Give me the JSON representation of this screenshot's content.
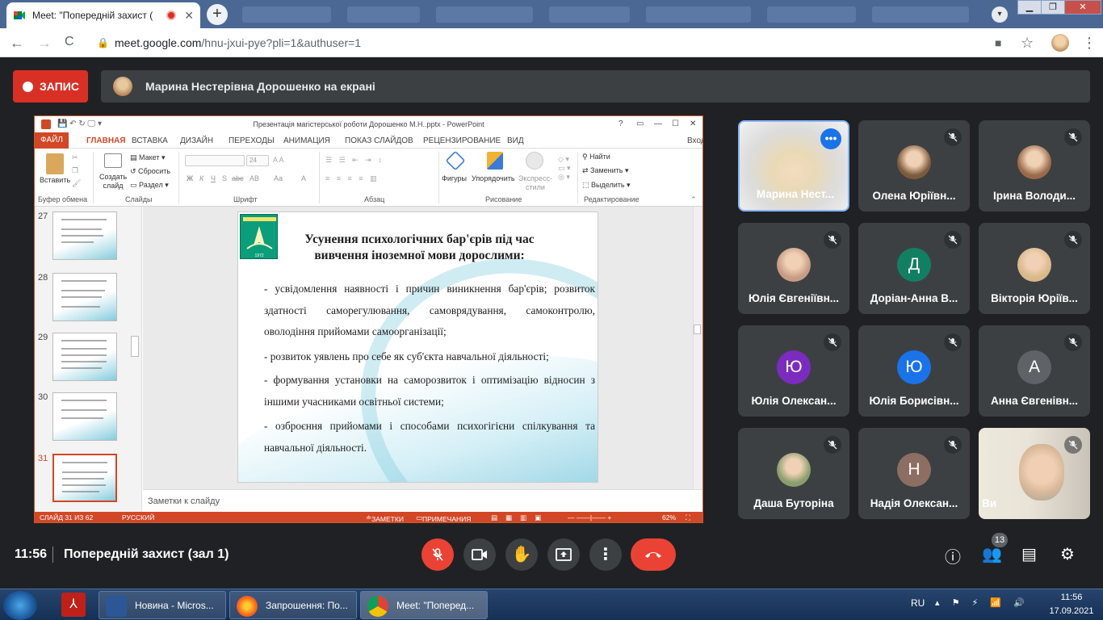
{
  "browser": {
    "tab_title": "Meet: \"Попередній захист (",
    "close_glyph": "✕",
    "new_tab_glyph": "+",
    "back_glyph": "←",
    "forward_glyph": "→",
    "reload_glyph": "C",
    "lock_glyph": "🔒",
    "url_host": "meet.google.com",
    "url_path": "/hnu-jxui-pye?pli=1&authuser=1",
    "star_glyph": "☆",
    "menu_glyph": "⋮",
    "window_buttons": [
      "▁",
      "❐",
      "✕"
    ]
  },
  "meet": {
    "record_label": "ЗАПИС",
    "presenter_text": "Марина Нестерівна Дорошенко на екрані",
    "time": "11:56",
    "meeting_title": "Попередній захист (зал 1)",
    "participants_count": "13",
    "tiles": [
      {
        "name": "Марина Нест...",
        "kind": "video"
      },
      {
        "name": "Олена Юріївн...",
        "kind": "photo",
        "color": "#7d5a3c"
      },
      {
        "name": "Ірина Володи...",
        "kind": "photo",
        "color": "#9a6b4a"
      },
      {
        "name": "Юлія Євгеніївн...",
        "kind": "photo",
        "color": "#c79b86"
      },
      {
        "name": "Доріан-Анна В...",
        "kind": "letter",
        "letter": "Д",
        "color": "#137f62"
      },
      {
        "name": "Вікторія Юріїв...",
        "kind": "photo",
        "color": "#d9b88a"
      },
      {
        "name": "Юлія Олексан...",
        "kind": "letter",
        "letter": "Ю",
        "color": "#7b2cbf"
      },
      {
        "name": "Юлія Борисівн...",
        "kind": "letter",
        "letter": "Ю",
        "color": "#1a73e8"
      },
      {
        "name": "Анна Євгенівн...",
        "kind": "letter",
        "letter": "А",
        "color": "#5f6368"
      },
      {
        "name": "Даша Буторіна",
        "kind": "photo",
        "color": "#8a9e6e"
      },
      {
        "name": "Надія Олексан...",
        "kind": "letter",
        "letter": "Н",
        "color": "#8d6e63"
      },
      {
        "name": "Ви",
        "kind": "video-self"
      }
    ],
    "mute_glyph": "🎙",
    "more_glyph": "•••"
  },
  "ppt": {
    "window_title": "Презентація магістерської роботи Дорошенко М.Н..pptx - PowerPoint",
    "title_buttons": [
      "?",
      "▭",
      "—",
      "☐",
      "✕"
    ],
    "menu": {
      "file": "ФАЙЛ",
      "tabs": [
        "ГЛАВНАЯ",
        "ВСТАВКА",
        "ДИЗАЙН",
        "ПЕРЕХОДЫ",
        "АНИМАЦИЯ",
        "ПОКАЗ СЛАЙДОВ",
        "РЕЦЕНЗИРОВАНИЕ",
        "ВИД"
      ],
      "login": "Вход"
    },
    "ribbon": {
      "paste": "Вставить",
      "new_slide": "Создать слайд",
      "layout": "Макет",
      "reset": "Сбросить",
      "section": "Раздел",
      "font_size": "24",
      "font_btns": [
        "Ж",
        "К",
        "Ч",
        "S",
        "abc",
        "АВ",
        "Аа",
        "А"
      ],
      "shapes": "Фигуры",
      "arrange": "Упорядочить",
      "quick_styles": "Экспресс-стили",
      "find": "Найти",
      "replace": "Заменить",
      "select": "Выделить",
      "groups": [
        "Буфер обмена",
        "Слайды",
        "Шрифт",
        "Абзац",
        "Рисование",
        "Редактирование"
      ]
    },
    "thumbs": [
      "27",
      "28",
      "29",
      "30",
      "31"
    ],
    "slide": {
      "title": "Усунення психологічних бар'єрів під час вивчення іноземної мови дорослими:",
      "bullets": [
        "-   усвідомлення наявності і причин виникнення бар'єрів; розвиток здатності саморегулювання, самоврядування, самоконтролю, оволодіння прийомами самоорганізації;",
        "- розвиток уявлень про себе як суб'єкта навчальної діяльності;",
        "-  формування установки на саморозвиток і оптимізацію відносин з іншими учасниками освітньої системи;",
        "- озброєння прийомами і способами психогігієни спілкування та навчальної діяльності."
      ]
    },
    "notes_placeholder": "Заметки к слайду",
    "status": {
      "slide_count": "СЛАЙД 31 ИЗ 62",
      "language": "РУССКИЙ",
      "notes": "ЗАМЕТКИ",
      "comments": "ПРИМЕЧАНИЯ",
      "zoom": "62%"
    }
  },
  "taskbar": {
    "items": [
      "Новина - Micros...",
      "Запрошення: По...",
      "Meet: \"Поперед..."
    ],
    "lang": "RU",
    "time": "11:56",
    "date": "17.09.2021"
  }
}
